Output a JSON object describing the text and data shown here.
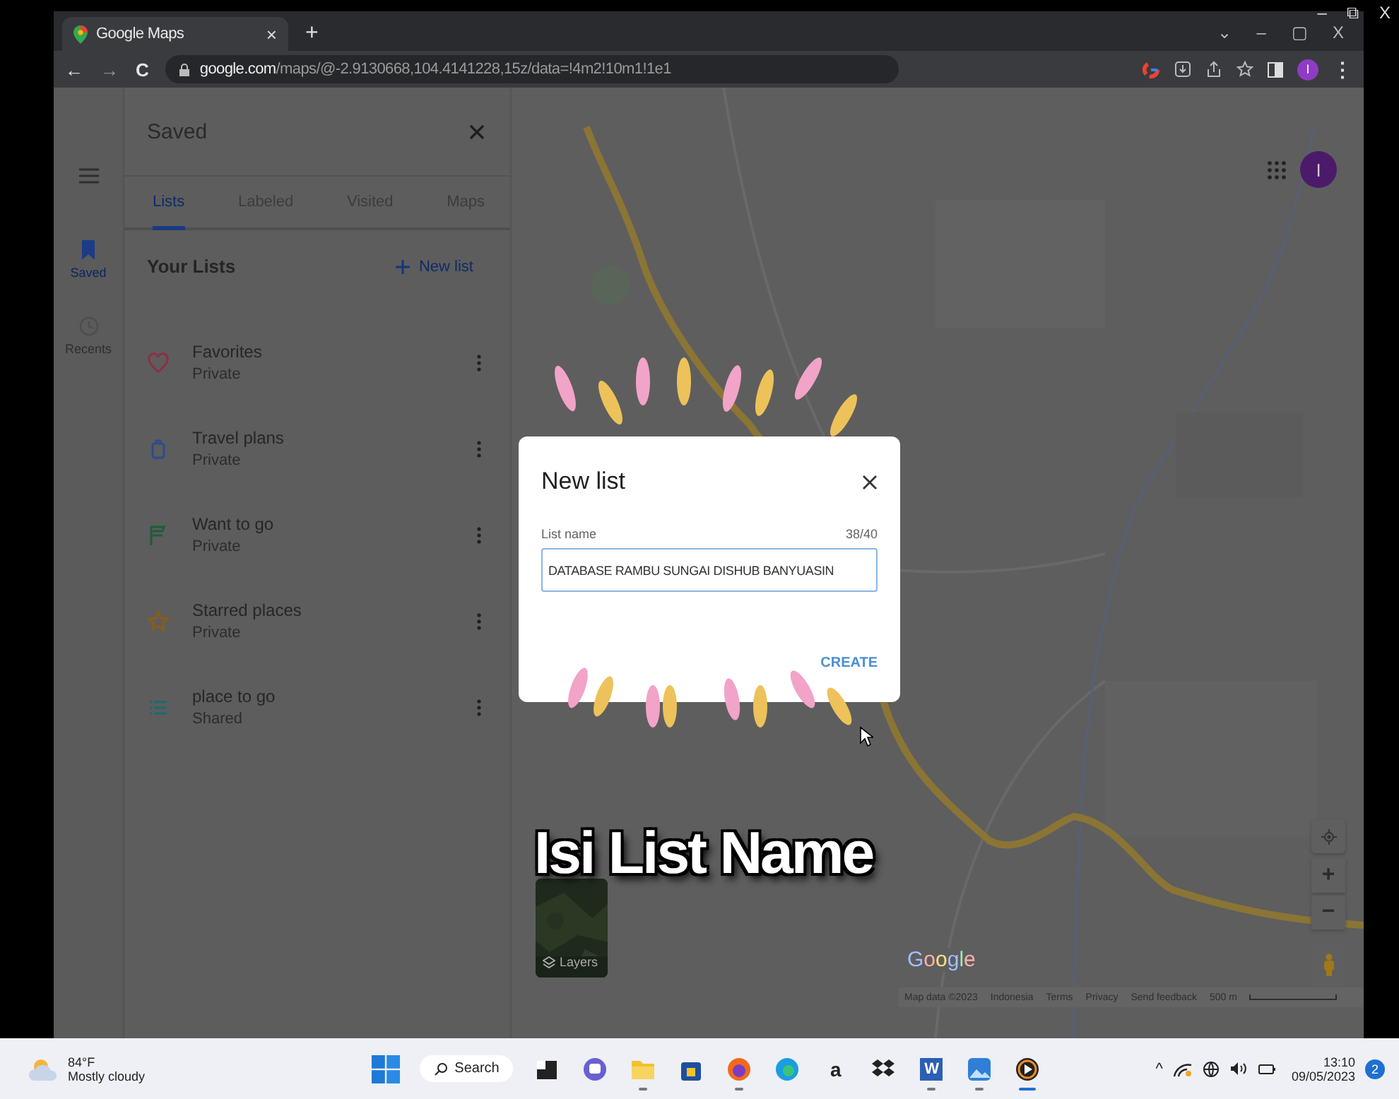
{
  "player_controls": [
    "–",
    "⧉",
    "X"
  ],
  "browser": {
    "tab": {
      "title": "Google Maps",
      "close": "×"
    },
    "new_tab": "+",
    "window_controls": [
      "⌄",
      "–",
      "▢",
      "X"
    ],
    "nav": [
      "←",
      "→",
      "C"
    ],
    "url": {
      "host": "google.com",
      "path": "/maps/@-2.9130668,104.4141228,15z/data=!4m2!10m1!1e1"
    },
    "profile_initial": "I",
    "menu": "⋮"
  },
  "rail": [
    {
      "label": "Saved",
      "kind": "saved",
      "selected": true
    },
    {
      "label": "Recents",
      "kind": "recents",
      "selected": false
    }
  ],
  "panel": {
    "title": "Saved",
    "tabs": [
      {
        "label": "Lists",
        "selected": true
      },
      {
        "label": "Labeled",
        "selected": false
      },
      {
        "label": "Visited",
        "selected": false
      },
      {
        "label": "Maps",
        "selected": false
      }
    ],
    "section": "Your Lists",
    "new_list": "New list",
    "lists": [
      {
        "name": "Favorites",
        "access": "Private",
        "kind": "heart"
      },
      {
        "name": "Travel plans",
        "access": "Private",
        "kind": "suitcase"
      },
      {
        "name": "Want to go",
        "access": "Private",
        "kind": "flag"
      },
      {
        "name": "Starred places",
        "access": "Private",
        "kind": "star"
      },
      {
        "name": "place to go",
        "access": "Shared",
        "kind": "list"
      }
    ]
  },
  "map": {
    "kind": "picture",
    "account_initial": "I",
    "layers": "Layers",
    "zoom_in": "+",
    "zoom_out": "−",
    "logo": "Google",
    "footer": [
      "Map data ©2023",
      "Indonesia",
      "Terms",
      "Privacy",
      "Send feedback"
    ],
    "scale": "500 m"
  },
  "dialog": {
    "title": "New list",
    "field_label": "List name",
    "counter": "38/40",
    "value": "DATABASE RAMBU SUNGAI DISHUB BANYUASIN",
    "action": "CREATE"
  },
  "caption": "Isi List Name",
  "taskbar": {
    "weather": {
      "temp": "84°F",
      "condition": "Mostly cloudy"
    },
    "search": "Search",
    "apps": [
      {
        "kind": "terminal",
        "running": false,
        "selected": false
      },
      {
        "kind": "chat",
        "running": false,
        "selected": false
      },
      {
        "kind": "files",
        "running": true,
        "selected": false
      },
      {
        "kind": "store",
        "running": false,
        "selected": false
      },
      {
        "kind": "firefox",
        "running": true,
        "selected": false
      },
      {
        "kind": "edge",
        "running": false,
        "selected": false
      },
      {
        "kind": "amazon",
        "glyph": "a",
        "running": false,
        "selected": false
      },
      {
        "kind": "dropbox",
        "running": false,
        "selected": false
      },
      {
        "kind": "word",
        "glyph": "W",
        "running": true,
        "selected": false
      },
      {
        "kind": "photos",
        "running": true,
        "selected": false
      },
      {
        "kind": "media",
        "running": true,
        "selected": true
      }
    ],
    "tray_caret": "^",
    "time": "13:10",
    "date": "09/05/2023",
    "badge": "2"
  }
}
